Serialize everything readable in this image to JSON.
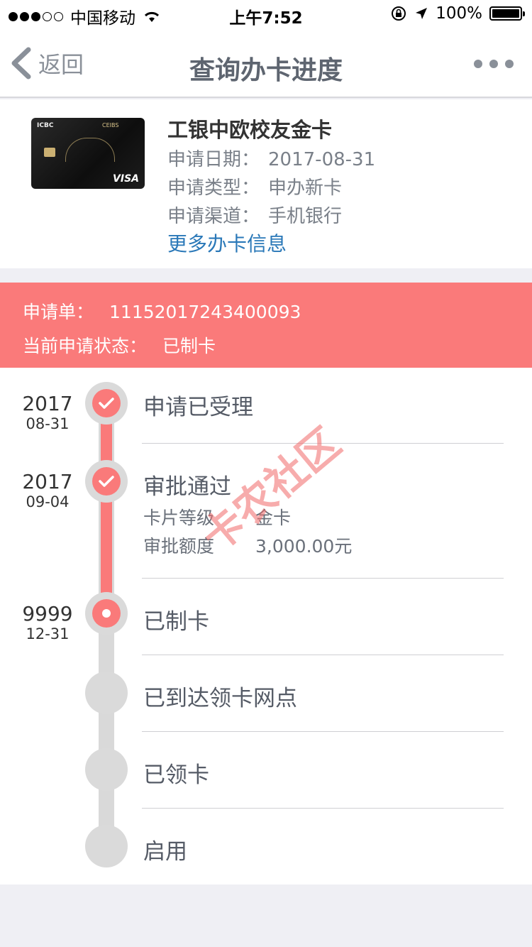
{
  "status_bar": {
    "carrier": "中国移动",
    "time": "上午7:52",
    "battery": "100%",
    "signal_bars_filled": 3,
    "signal_bars_total": 5
  },
  "nav": {
    "back_label": "返回",
    "title": "查询办卡进度"
  },
  "card": {
    "name": "工银中欧校友金卡",
    "image_bank_text": "ICBC",
    "image_partner_text": "CEIBS",
    "image_network_text": "VISA",
    "fields": [
      {
        "label": "申请日期：",
        "value": "2017-08-31"
      },
      {
        "label": "申请类型：",
        "value": "申办新卡"
      },
      {
        "label": "申请渠道：",
        "value": "手机银行"
      }
    ],
    "more_link": "更多办卡信息"
  },
  "application": {
    "number_label": "申请单：",
    "number": "11152017243400093",
    "status_label": "当前申请状态：",
    "status": "已制卡"
  },
  "timeline": [
    {
      "title": "申请已受理",
      "year": "2017",
      "date": "08-31",
      "state": "done"
    },
    {
      "title": "审批通过",
      "year": "2017",
      "date": "09-04",
      "state": "done",
      "details": [
        {
          "label": "卡片等级",
          "value": "金卡"
        },
        {
          "label": "审批额度",
          "value": "3,000.00元"
        }
      ]
    },
    {
      "title": "已制卡",
      "year": "9999",
      "date": "12-31",
      "state": "current"
    },
    {
      "title": "已到达领卡网点",
      "state": "pending"
    },
    {
      "title": "已领卡",
      "state": "pending"
    },
    {
      "title": "启用",
      "state": "pending"
    }
  ],
  "watermark": "卡农社区",
  "colors": {
    "accent_red": "#fa7a7a",
    "link_blue": "#2a78b8",
    "track_grey": "#d9d9d9"
  }
}
